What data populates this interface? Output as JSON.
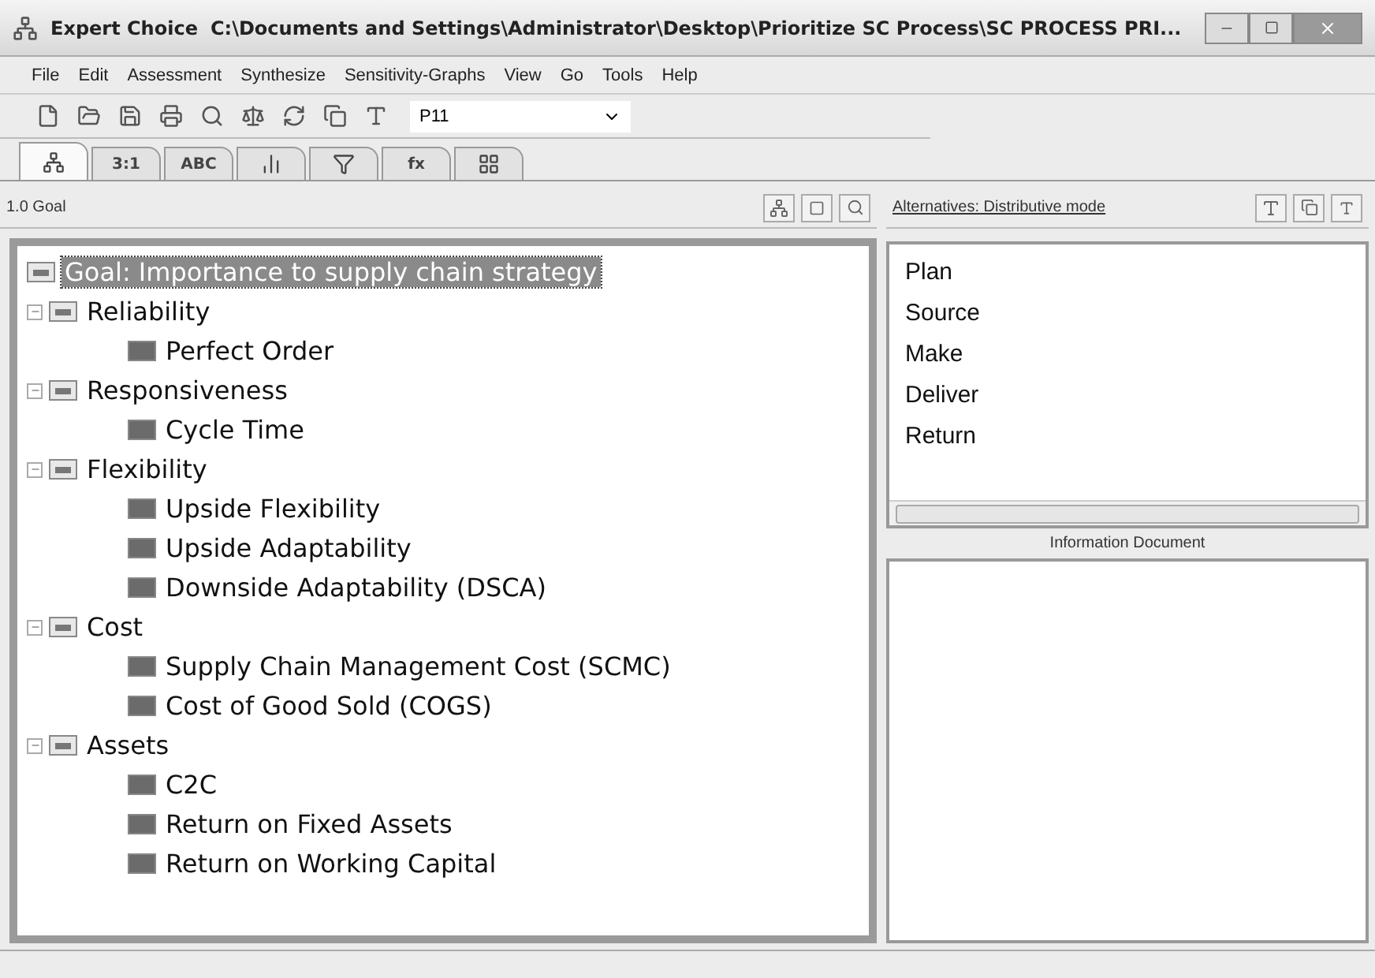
{
  "window": {
    "app": "Expert Choice",
    "path": "C:\\Documents and Settings\\Administrator\\Desktop\\Prioritize SC Process\\SC PROCESS PRI..."
  },
  "menu": [
    "File",
    "Edit",
    "Assessment",
    "Synthesize",
    "Sensitivity-Graphs",
    "View",
    "Go",
    "Tools",
    "Help"
  ],
  "toolbar": {
    "combo": "P11"
  },
  "tabs": [
    {
      "kind": "tree",
      "selected": true
    },
    {
      "kind": "text",
      "label": "3:1",
      "selected": false
    },
    {
      "kind": "text",
      "label": "ABC",
      "selected": false
    },
    {
      "kind": "bars",
      "selected": false
    },
    {
      "kind": "funnel",
      "selected": false
    },
    {
      "kind": "text",
      "label": "fx",
      "selected": false
    },
    {
      "kind": "grid",
      "selected": false
    }
  ],
  "left_header": "1.0 Goal",
  "tree": {
    "label": "Goal: Importance to supply chain strategy",
    "selected": true,
    "children": [
      {
        "label": "Reliability",
        "expanded": true,
        "children": [
          {
            "label": "Perfect Order"
          }
        ]
      },
      {
        "label": "Responsiveness",
        "expanded": true,
        "children": [
          {
            "label": "Cycle Time"
          }
        ]
      },
      {
        "label": "Flexibility",
        "expanded": true,
        "children": [
          {
            "label": "Upside Flexibility"
          },
          {
            "label": "Upside Adaptability"
          },
          {
            "label": "Downside Adaptability (DSCA)"
          }
        ]
      },
      {
        "label": "Cost",
        "expanded": true,
        "children": [
          {
            "label": "Supply Chain Management Cost (SCMC)"
          },
          {
            "label": "Cost of Good Sold (COGS)"
          }
        ]
      },
      {
        "label": "Assets",
        "expanded": true,
        "children": [
          {
            "label": "C2C"
          },
          {
            "label": "Return on Fixed Assets"
          },
          {
            "label": "Return on Working Capital"
          }
        ]
      }
    ]
  },
  "alternatives": {
    "header": "Alternatives: Distributive mode",
    "items": [
      "Plan",
      "Source",
      "Make",
      "Deliver",
      "Return"
    ]
  },
  "info_label": "Information Document"
}
